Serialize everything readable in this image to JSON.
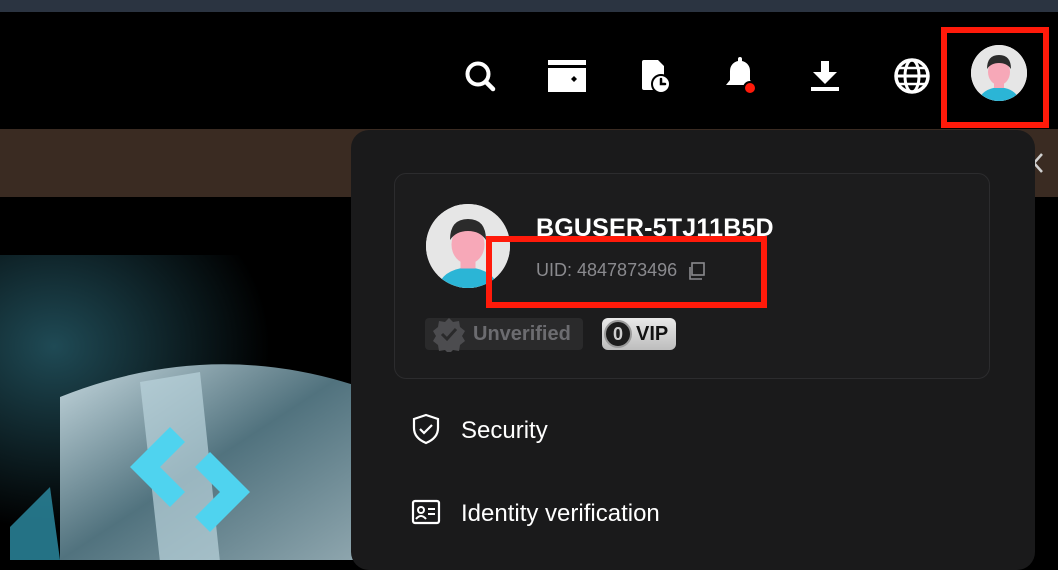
{
  "navbar": {
    "icons": [
      "search-icon",
      "wallet-icon",
      "history-icon",
      "bell-icon",
      "download-icon",
      "globe-icon",
      "avatar"
    ],
    "accent_red": "#ff1a0a"
  },
  "profile": {
    "username": "BGUSER-5TJ11B5D",
    "uid_label": "UID:",
    "uid_value": "4847873496",
    "verification_badge": "Unverified",
    "vip_level": "0",
    "vip_label": "VIP"
  },
  "menu": {
    "items": [
      {
        "label": "Security",
        "icon": "shield-check-icon"
      },
      {
        "label": "Identity verification",
        "icon": "id-card-icon"
      }
    ]
  }
}
